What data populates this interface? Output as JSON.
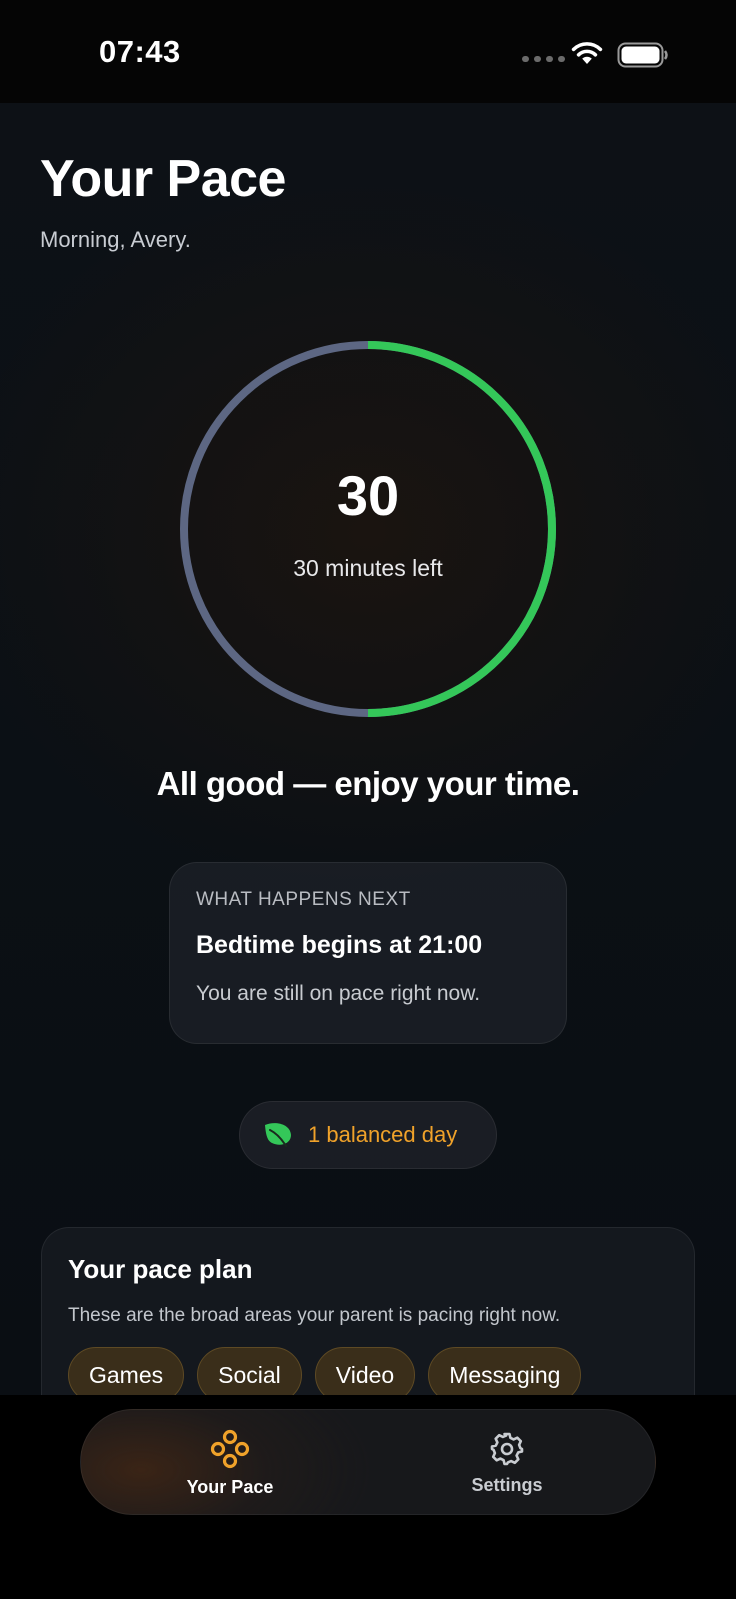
{
  "status_bar": {
    "time": "07:43"
  },
  "header": {
    "title": "Your Pace",
    "greeting": "Morning, Avery."
  },
  "ring": {
    "value": "30",
    "label": "30 minutes left",
    "remaining_fraction": 0.5,
    "colors": {
      "remaining": "#34c759",
      "used": "#5d6783"
    }
  },
  "status_message": "All good — enjoy your time.",
  "next_card": {
    "eyebrow": "WHAT HAPPENS NEXT",
    "title": "Bedtime begins at 21:00",
    "subtitle": "You are still on pace right now."
  },
  "streak": {
    "icon": "leaf-icon",
    "label": "1 balanced day",
    "color": "#f0a22a"
  },
  "pace_plan": {
    "title": "Your pace plan",
    "description": "These are the broad areas your parent is pacing right now.",
    "chips": [
      "Games",
      "Social",
      "Video",
      "Messaging"
    ]
  },
  "tab_bar": {
    "items": [
      {
        "label": "Your Pace",
        "icon": "pace-icon",
        "active": true,
        "accent": "#f0a22a"
      },
      {
        "label": "Settings",
        "icon": "gear-icon",
        "active": false
      }
    ]
  }
}
